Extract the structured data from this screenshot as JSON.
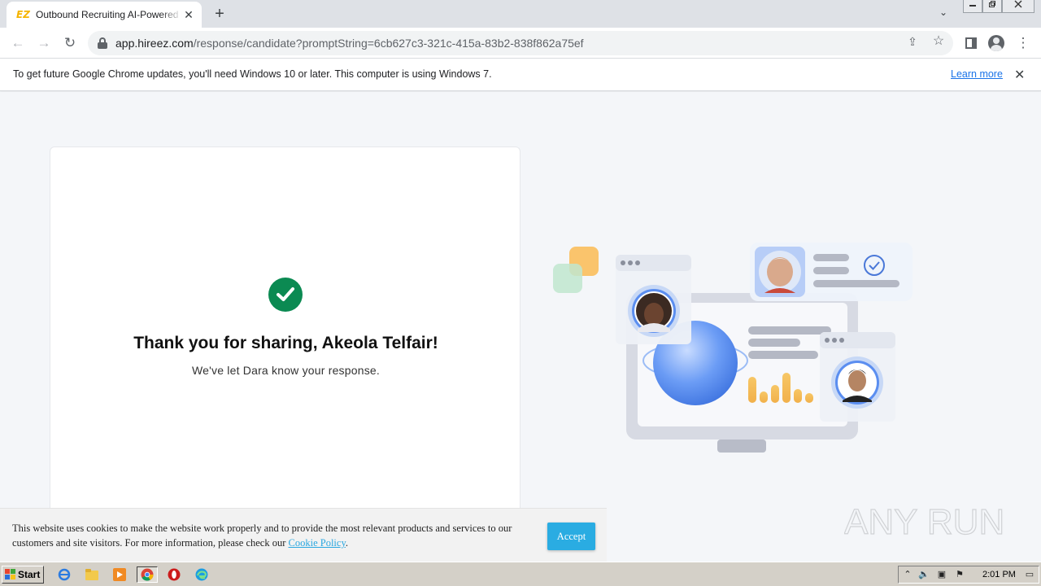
{
  "browser": {
    "tab": {
      "favicon_text": "EZ",
      "title": "Outbound Recruiting AI-Powered Platform | hireEZ",
      "close_glyph": "✕"
    },
    "new_tab_glyph": "+",
    "address_bar": {
      "host": "app.hireez.com",
      "path": "/response/candidate?promptString=6cb627c3-321c-415a-83b2-838f862a75ef"
    },
    "icons": {
      "back": "←",
      "forward": "→",
      "reload": "↻",
      "share": "⇪",
      "star": "☆",
      "side_panel": "▮",
      "menu": "⋮",
      "tab_search": "⌄"
    }
  },
  "infobar": {
    "message": "To get future Google Chrome updates, you'll need Windows 10 or later. This computer is using Windows 7.",
    "link": "Learn more",
    "close_glyph": "✕"
  },
  "confirmation": {
    "title": "Thank you for sharing, Akeola Telfair!",
    "subtitle": "We've let Dara know your response."
  },
  "cookie_banner": {
    "text": "This website uses cookies to make the website work properly and to provide the most relevant products and services to our customers and site visitors. For more information, please check our ",
    "link": "Cookie Policy",
    "end": ".",
    "accept_label": "Accept"
  },
  "watermark": {
    "text": "ANY RUN"
  },
  "taskbar": {
    "start_label": "Start",
    "clock": "2:01 PM"
  },
  "colors": {
    "success_green": "#0b8a52",
    "accept_blue": "#2aace2",
    "link_blue": "#1a73e8"
  }
}
